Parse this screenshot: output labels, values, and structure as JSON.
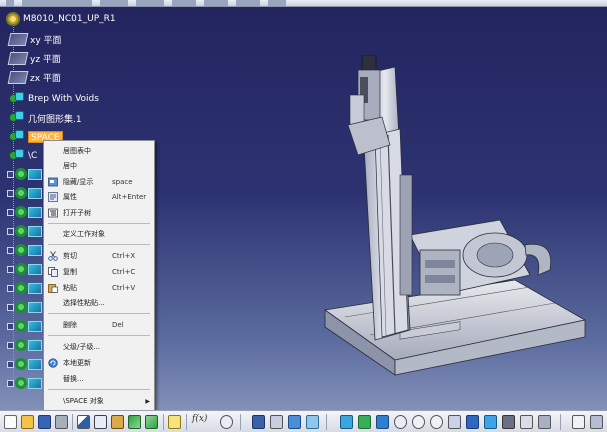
{
  "title_bar": {
    "blurred": true
  },
  "tree": {
    "root_label": "M8010_NC01_UP_R1",
    "items": [
      {
        "label": "xy 平面",
        "icon": "plane-icon"
      },
      {
        "label": "yz 平面",
        "icon": "plane-icon"
      },
      {
        "label": "zx 平面",
        "icon": "plane-icon"
      },
      {
        "label": "Brep With Voids",
        "icon": "product-node-icon"
      },
      {
        "label": "几何图形集.1",
        "icon": "product-node-icon"
      },
      {
        "label": "SPACE",
        "icon": "product-node-icon",
        "selected": true
      }
    ],
    "partial_label": "\\C",
    "selection_color": "#ffb23c"
  },
  "context_menu": {
    "items": [
      {
        "label": "居图表中",
        "shortcut": "",
        "icon": ""
      },
      {
        "label": "居中",
        "shortcut": "",
        "icon": ""
      },
      {
        "label": "隐藏/显示",
        "shortcut": "space",
        "icon": "hide-show-icon"
      },
      {
        "label": "属性",
        "shortcut": "Alt+Enter",
        "icon": "properties-icon"
      },
      {
        "label": "打开子树",
        "shortcut": "",
        "icon": "open-subtree-icon"
      },
      {
        "label": "定义工作对象",
        "shortcut": "",
        "icon": ""
      },
      {
        "label": "剪切",
        "shortcut": "Ctrl+X",
        "icon": "scissors-icon"
      },
      {
        "label": "复制",
        "shortcut": "Ctrl+C",
        "icon": "copy-icon"
      },
      {
        "label": "粘贴",
        "shortcut": "Ctrl+V",
        "icon": "paste-icon"
      },
      {
        "label": "选择性粘贴...",
        "shortcut": "",
        "icon": ""
      },
      {
        "label": "删除",
        "shortcut": "Del",
        "icon": ""
      },
      {
        "label": "父级/子级...",
        "shortcut": "",
        "icon": ""
      },
      {
        "label": "本地更新",
        "shortcut": "",
        "icon": "local-update-icon"
      },
      {
        "label": "替换...",
        "shortcut": "",
        "icon": ""
      },
      {
        "label": "\\SPACE 对象",
        "shortcut": "",
        "icon": "",
        "submenu": true
      }
    ]
  },
  "toolbar": {
    "formula_label": "f(x)",
    "buttons": [
      "new-icon",
      "open-icon",
      "save-icon",
      "print-icon",
      "cut-icon",
      "copy-icon",
      "paste-icon",
      "undo-icon",
      "redo-icon",
      "what-is-this-icon",
      "formula-icon",
      "comment-icon",
      "catalog-icon",
      "sketch-icon",
      "pan-icon",
      "rotate-icon",
      "zoom-in-icon",
      "zoom-out-icon",
      "normal-view-icon",
      "iso-view-icon",
      "shading-icon",
      "hide-show-icon",
      "swap-space-icon",
      "measure-icon",
      "apply-material-icon"
    ]
  }
}
